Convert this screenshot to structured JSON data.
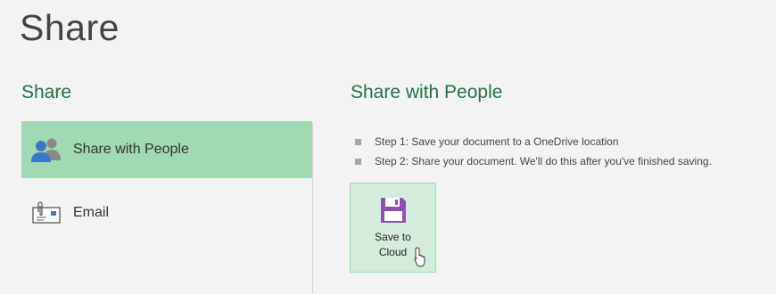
{
  "page": {
    "title": "Share"
  },
  "left_panel": {
    "heading": "Share",
    "items": [
      {
        "label": "Share with People",
        "icon": "people-icon",
        "selected": true
      },
      {
        "label": "Email",
        "icon": "email-icon",
        "selected": false
      }
    ]
  },
  "right_panel": {
    "heading": "Share with People",
    "steps": [
      "Step 1: Save your document to a OneDrive location",
      "Step 2: Share your document. We'll do this after you've finished saving."
    ],
    "save_button": {
      "label": "Save to Cloud",
      "icon": "floppy-disk-icon"
    }
  },
  "colors": {
    "accent_green": "#217346",
    "selected_bg": "#a0d9b2",
    "button_bg": "#d5ecdc",
    "save_icon": "#8e4fb0"
  }
}
